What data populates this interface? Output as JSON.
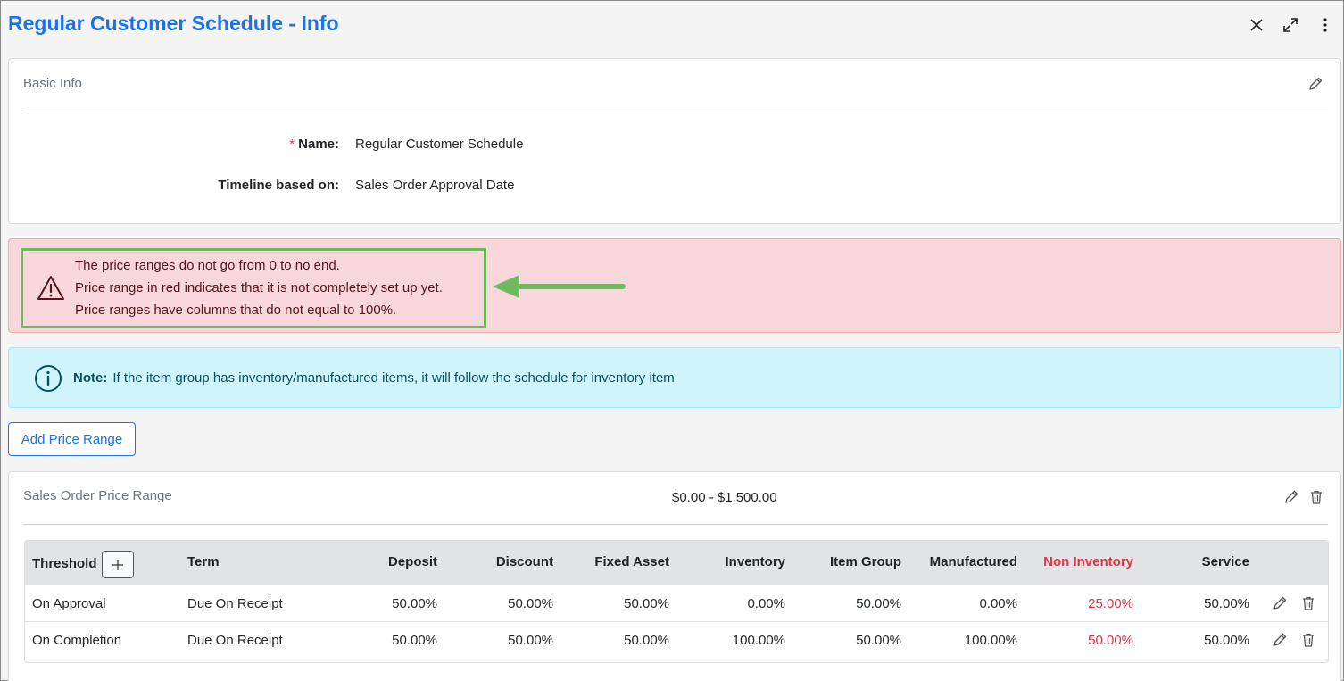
{
  "header": {
    "title": "Regular Customer Schedule - Info",
    "icons": [
      "close-icon",
      "expand-icon",
      "more-vertical-icon"
    ]
  },
  "basic_info": {
    "section_title": "Basic Info",
    "fields": [
      {
        "label": "Name:",
        "required_marker": "*",
        "value": "Regular Customer Schedule"
      },
      {
        "label": "Timeline based on:",
        "value": "Sales Order Approval Date"
      }
    ]
  },
  "warning_alert": {
    "lines": [
      "The price ranges do not go from 0 to no end.",
      "Price range in red indicates that it is not completely set up yet.",
      "Price ranges have columns that do not equal to 100%."
    ]
  },
  "note_alert": {
    "label": "Note:",
    "text": "If the item group has inventory/manufactured items, it will follow the schedule for inventory item"
  },
  "add_price_range_label": "Add Price Range",
  "price_range": {
    "title": "Sales Order Price Range",
    "range": "$0.00 - $1,500.00",
    "columns": [
      "Threshold",
      "Term",
      "Deposit",
      "Discount",
      "Fixed Asset",
      "Inventory",
      "Item Group",
      "Manufactured",
      "Non Inventory",
      "Service"
    ],
    "rows": [
      {
        "threshold": "On Approval",
        "term": "Due On Receipt",
        "deposit": "50.00%",
        "discount": "50.00%",
        "fixed_asset": "50.00%",
        "inventory": "0.00%",
        "item_group": "50.00%",
        "manufactured": "0.00%",
        "non_inventory": "25.00%",
        "service": "50.00%"
      },
      {
        "threshold": "On Completion",
        "term": "Due On Receipt",
        "deposit": "50.00%",
        "discount": "50.00%",
        "fixed_asset": "50.00%",
        "inventory": "100.00%",
        "item_group": "50.00%",
        "manufactured": "100.00%",
        "non_inventory": "50.00%",
        "service": "50.00%"
      }
    ]
  },
  "colors": {
    "title_blue": "#1a73e8",
    "danger_red": "#dc3545",
    "highlight_green": "#6dbb5e",
    "alert_danger_bg": "#f7d7da",
    "alert_info_bg": "#cff4fc"
  }
}
